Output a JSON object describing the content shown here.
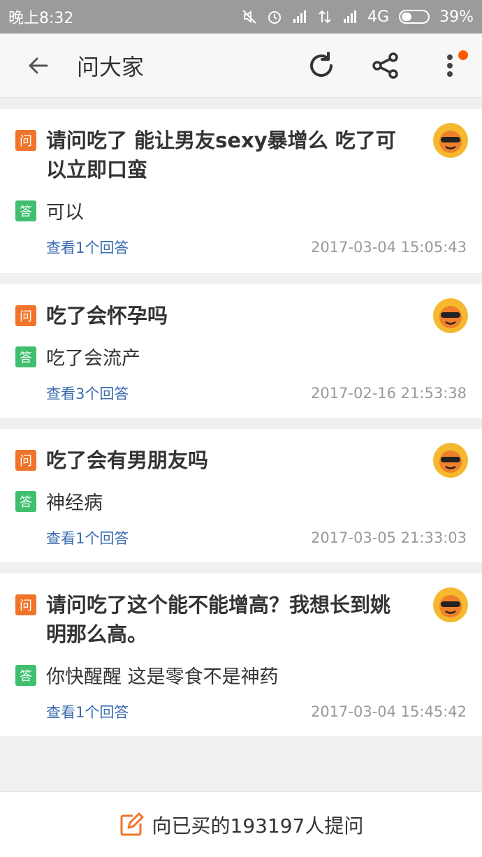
{
  "status_bar": {
    "time": "晚上8:32",
    "network": "4G",
    "battery": "39%"
  },
  "header": {
    "title": "问大家"
  },
  "questions": [
    {
      "question": "请问吃了 能让男友sexy暴增么 吃了可以立即口蛮",
      "answer": "可以",
      "view_answers": "查看1个回答",
      "timestamp": "2017-03-04 15:05:43"
    },
    {
      "question": "吃了会怀孕吗",
      "answer": "吃了会流产",
      "view_answers": "查看3个回答",
      "timestamp": "2017-02-16 21:53:38"
    },
    {
      "question": "吃了会有男朋友吗",
      "answer": "神经病",
      "view_answers": "查看1个回答",
      "timestamp": "2017-03-05 21:33:03"
    },
    {
      "question": "请问吃了这个能不能增高？我想长到姚明那么高。",
      "answer": "你快醒醒 这是零食不是神药",
      "view_answers": "查看1个回答",
      "timestamp": "2017-03-04 15:45:42"
    }
  ],
  "labels": {
    "question_tag": "问",
    "answer_tag": "答"
  },
  "bottom_bar": {
    "ask_label": "向已买的193197人提问"
  },
  "colors": {
    "accent": "#f0752a",
    "answer_tag": "#3fbf6e",
    "link": "#3a6cb0",
    "badge": "#ff5a00"
  }
}
